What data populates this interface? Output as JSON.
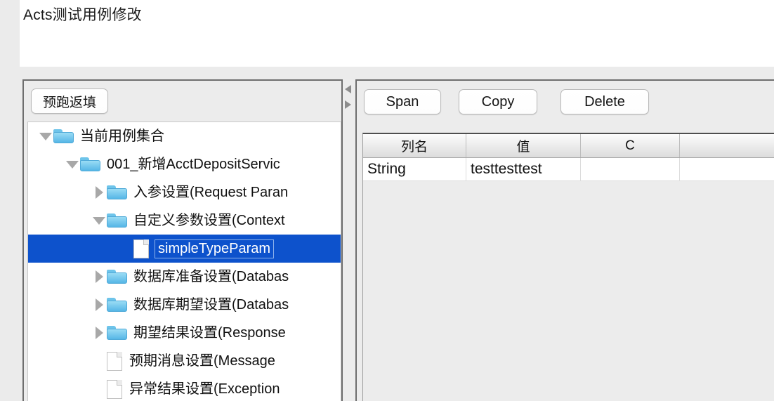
{
  "window": {
    "title": "Acts测试用例修改"
  },
  "left_panel": {
    "toolbar": {
      "prerun_label": "预跑返填"
    },
    "tree": {
      "nodes": [
        {
          "label": "当前用例集合",
          "icon": "folder-icon",
          "twisty": "open",
          "indent": 0,
          "selected": false
        },
        {
          "label": "001_新增AcctDepositServic",
          "icon": "folder-icon",
          "twisty": "open",
          "indent": 1,
          "selected": false
        },
        {
          "label": "入参设置(Request Paran",
          "icon": "folder-icon",
          "twisty": "closed",
          "indent": 2,
          "selected": false
        },
        {
          "label": "自定义参数设置(Context",
          "icon": "folder-icon",
          "twisty": "open",
          "indent": 2,
          "selected": false
        },
        {
          "label": "simpleTypeParam",
          "icon": "file-icon",
          "twisty": "none",
          "indent": 3,
          "selected": true
        },
        {
          "label": "数据库准备设置(Databas",
          "icon": "folder-icon",
          "twisty": "closed",
          "indent": 2,
          "selected": false
        },
        {
          "label": "数据库期望设置(Databas",
          "icon": "folder-icon",
          "twisty": "closed",
          "indent": 2,
          "selected": false
        },
        {
          "label": "期望结果设置(Response",
          "icon": "folder-icon",
          "twisty": "closed",
          "indent": 2,
          "selected": false
        },
        {
          "label": "预期消息设置(Message ",
          "icon": "file-icon",
          "twisty": "none",
          "indent": 2,
          "selected": false
        },
        {
          "label": "异常结果设置(Exception",
          "icon": "file-icon",
          "twisty": "none",
          "indent": 2,
          "selected": false
        }
      ]
    }
  },
  "splitter": {
    "collapse_left_icon": "triangle-left-icon",
    "collapse_right_icon": "triangle-right-icon"
  },
  "right_panel": {
    "toolbar": {
      "buttons": [
        {
          "label": "Span"
        },
        {
          "label": "Copy"
        },
        {
          "label": "Delete"
        }
      ]
    },
    "table": {
      "headers": [
        "列名",
        "值",
        "C",
        ""
      ],
      "rows": [
        {
          "cells": [
            "String",
            "testtesttest",
            "",
            ""
          ]
        }
      ]
    }
  },
  "colors": {
    "selection_blue": "#0d52cc",
    "panel_gray": "#ececec",
    "border_dark": "#6e6e6e",
    "folder_blue": "#56b6e6"
  }
}
